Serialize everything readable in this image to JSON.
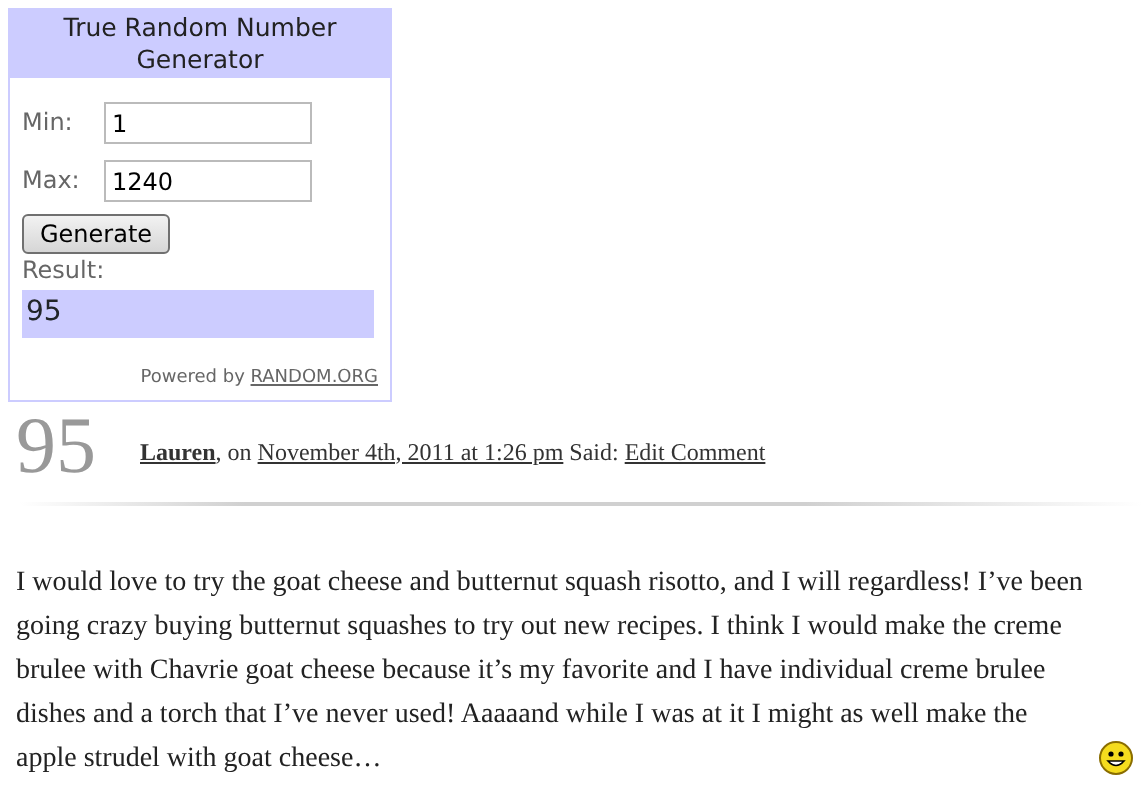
{
  "widget": {
    "title": "True Random Number Generator",
    "min_label": "Min:",
    "min_value": "1",
    "max_label": "Max:",
    "max_value": "1240",
    "button": "Generate",
    "result_label": "Result:",
    "result": "95",
    "powered_by": "Powered by",
    "powered_link": "RANDOM.ORG"
  },
  "comment": {
    "number": "95",
    "author": "Lauren",
    "on": ", on",
    "date": "November 4th, 2011 at 1:26 pm",
    "said": "Said:",
    "edit": "Edit Comment",
    "body": "I would love to try the goat cheese and butternut squash risotto, and I will regardless! I’ve been going crazy buying butternut squashes to try out new recipes. I think I would make the creme brulee with Chavrie goat cheese because it’s my favorite and I have individual creme brulee dishes and a torch that I’ve never used! Aaaaand while I was at it I might as well make the apple strudel with goat cheese…"
  }
}
